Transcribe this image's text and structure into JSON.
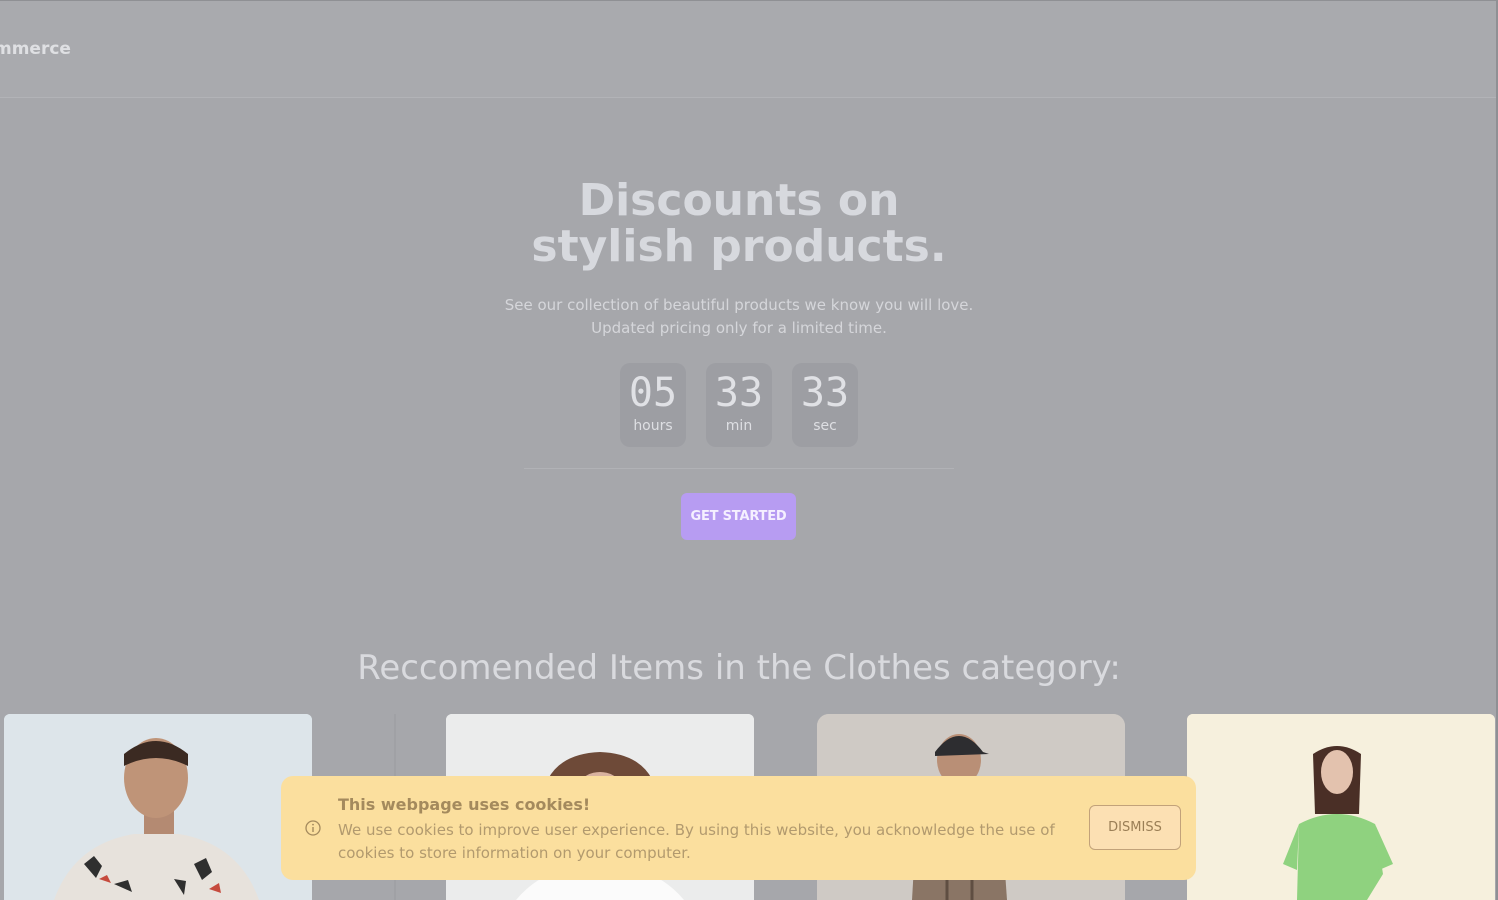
{
  "nav": {
    "brand": "mmerce"
  },
  "hero": {
    "title_line1": "Discounts on",
    "title_line2": "stylish products.",
    "subtitle_line1": "See our collection of beautiful products we know you will love.",
    "subtitle_line2": "Updated pricing only for a limited time.",
    "countdown": [
      {
        "value": "05",
        "unit": "hours"
      },
      {
        "value": "33",
        "unit": "min"
      },
      {
        "value": "33",
        "unit": "sec"
      }
    ],
    "cta_label": "GET STARTED",
    "cta_color": "#b79cf2"
  },
  "recommended": {
    "heading": "Reccomended Items in the Clothes category:"
  },
  "cookie_banner": {
    "title": "This webpage uses cookies!",
    "text": "We use cookies to improve user experience. By using this website, you acknowledge the use of cookies to store information on your computer.",
    "dismiss_label": "DISMISS",
    "icon": "info-icon",
    "background_color": "#fbdf9e"
  }
}
